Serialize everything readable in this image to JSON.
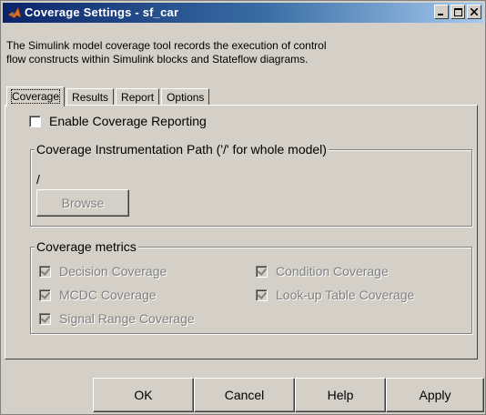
{
  "window": {
    "title": "Coverage Settings - sf_car",
    "icon": "matlab-logo-icon",
    "controls": [
      "minimize-icon",
      "maximize-icon",
      "close-icon"
    ]
  },
  "description": {
    "line1": "The Simulink model coverage tool records the execution of control",
    "line2": "flow constructs within Simulink blocks and Stateflow diagrams."
  },
  "tabs": [
    {
      "label": "Coverage",
      "active": true
    },
    {
      "label": "Results",
      "active": false
    },
    {
      "label": "Report",
      "active": false
    },
    {
      "label": "Options",
      "active": false
    }
  ],
  "coverage": {
    "enable_label": "Enable Coverage Reporting",
    "enable_checked": false,
    "instrumentation": {
      "legend": "Coverage Instrumentation Path ('/' for whole model)",
      "path_value": "/",
      "browse_label": "Browse"
    },
    "metrics": {
      "legend": "Coverage metrics",
      "items": [
        {
          "label": "Decision Coverage",
          "checked": true,
          "enabled": false
        },
        {
          "label": "Condition Coverage",
          "checked": true,
          "enabled": false
        },
        {
          "label": "MCDC Coverage",
          "checked": true,
          "enabled": false
        },
        {
          "label": "Look-up Table Coverage",
          "checked": true,
          "enabled": false
        },
        {
          "label": "Signal Range Coverage",
          "checked": true,
          "enabled": false
        }
      ]
    }
  },
  "buttons": {
    "ok": "OK",
    "cancel": "Cancel",
    "help": "Help",
    "apply": "Apply"
  },
  "colors": {
    "title_gradient_start": "#0a246a",
    "title_gradient_end": "#a6caf0",
    "dialog_face": "#d4d0c8",
    "disabled_text": "#808080"
  }
}
